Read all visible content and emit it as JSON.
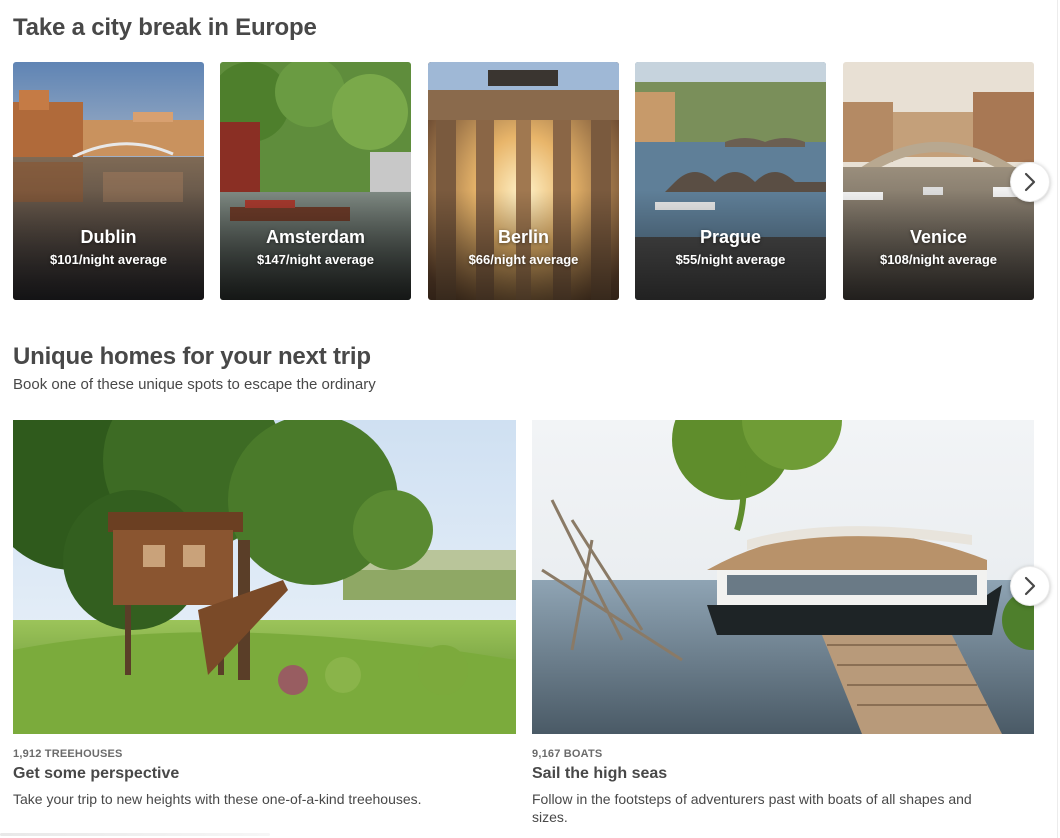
{
  "city_section": {
    "title": "Take a city break in Europe",
    "cities": [
      {
        "name": "Dublin",
        "price": "$101/night average"
      },
      {
        "name": "Amsterdam",
        "price": "$147/night average"
      },
      {
        "name": "Berlin",
        "price": "$66/night average"
      },
      {
        "name": "Prague",
        "price": "$55/night average"
      },
      {
        "name": "Venice",
        "price": "$108/night average"
      }
    ],
    "next_icon": "chevron-right-icon"
  },
  "homes_section": {
    "title": "Unique homes for your next trip",
    "subtitle": "Book one of these unique spots to escape the ordinary",
    "cards": [
      {
        "kicker": "1,912 TREEHOUSES",
        "title": "Get some perspective",
        "description": "Take your trip to new heights with these one-of-a-kind treehouses."
      },
      {
        "kicker": "9,167 BOATS",
        "title": "Sail the high seas",
        "description": "Follow in the footsteps of adventurers past with boats of all shapes and sizes."
      }
    ],
    "next_icon": "chevron-right-icon"
  }
}
